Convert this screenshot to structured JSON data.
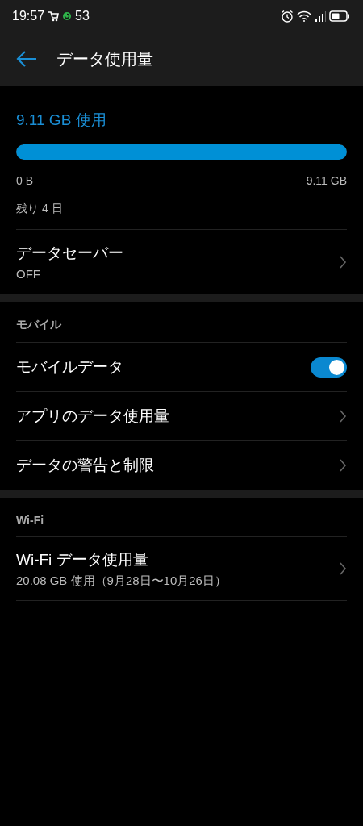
{
  "status_bar": {
    "time": "19:57",
    "notification_count": "53"
  },
  "app_bar": {
    "title": "データ使用量"
  },
  "usage": {
    "amount": "9.11 GB 使用",
    "level": 1,
    "min_label": "0 B",
    "max_label": "9.11 GB",
    "remaining": "残り 4 日"
  },
  "sections": [
    {
      "items": [
        {
          "kind": "nav",
          "title": "データセーバー",
          "subtitle": "OFF"
        }
      ]
    },
    {
      "header": "モバイル",
      "items": [
        {
          "kind": "toggle",
          "title": "モバイルデータ",
          "on": true
        },
        {
          "kind": "nav",
          "title": "アプリのデータ使用量"
        },
        {
          "kind": "nav",
          "title": "データの警告と制限"
        }
      ]
    },
    {
      "header": "Wi-Fi",
      "items": [
        {
          "kind": "nav",
          "title": "Wi-Fi データ使用量",
          "subtitle": "20.08 GB 使用（9月28日〜10月26日）"
        }
      ]
    }
  ]
}
